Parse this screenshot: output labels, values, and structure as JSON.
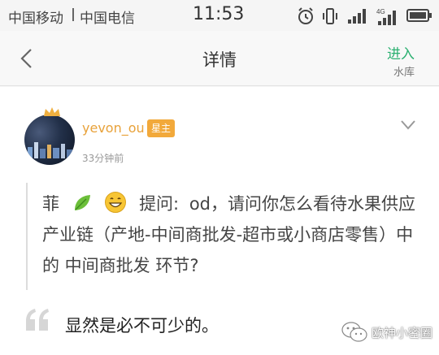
{
  "status_bar": {
    "carrier_1": "中国移动",
    "carrier_2": "中国电信",
    "time": "11:53",
    "icons": [
      "alarm-icon",
      "vibrate-icon",
      "signal-icon",
      "4g-signal-icon",
      "battery-icon"
    ]
  },
  "nav": {
    "title": "详情",
    "enter_label": "进入",
    "enter_sub": "水库"
  },
  "post": {
    "username": "yevon_ou",
    "badge": "星主",
    "time": "33分钟前",
    "asker_name": "菲",
    "question_prefix": "提问:",
    "question_body": "od，请问你怎么看待水果供应产业链（产地-中间商批发-超市或小商店零售）中的 中间商批发 环节?",
    "answer": "显然是必不可少的。"
  },
  "watermark": {
    "text": "欧神小密圈"
  },
  "colors": {
    "accent_green": "#2bb070",
    "username_orange": "#e8a23a",
    "badge_orange": "#f2a93b"
  }
}
